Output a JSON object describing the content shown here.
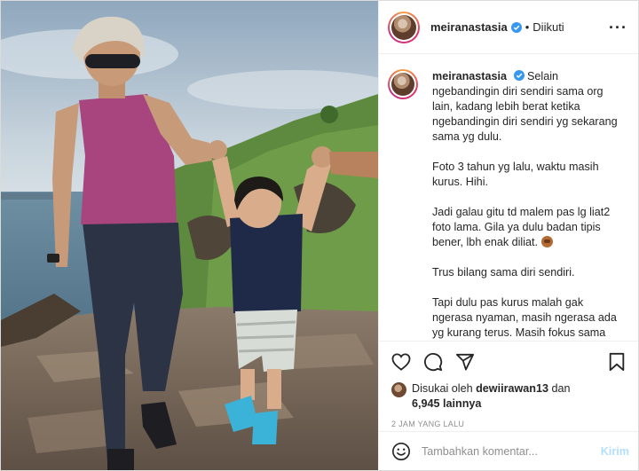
{
  "header": {
    "username": "meiranastasia",
    "separator": "•",
    "follow_status": "Diikuti",
    "more_glyph": "···"
  },
  "caption": {
    "username": "meiranastasia",
    "first_line": "Selain ngebandingin diri sendiri sama org lain, kadang lebih berat ketika ngebandingin diri sendiri yg sekarang sama yg dulu.",
    "paragraph_2": "Foto 3 tahun yg lalu, waktu masih kurus. Hihi.",
    "paragraph_3": "Jadi galau gitu td malem pas lg liat2 foto lama. Gila ya dulu badan tipis bener, lbh enak diliat.",
    "paragraph_3_emoji": "see-no-evil-monkey-emoji",
    "paragraph_4": "Trus bilang sama diri sendiri.",
    "paragraph_5": "Tapi dulu pas kurus malah gak ngerasa nyaman, masih ngerasa ada yg kurang terus. Masih fokus sama penampilan luar doang. Kalo ada yg"
  },
  "actions": {
    "icons": [
      "heart-icon",
      "comment-icon",
      "share-icon",
      "bookmark-icon"
    ]
  },
  "likes": {
    "prefix": "Disukai oleh",
    "user": "dewiirawan13",
    "conjunction": "dan",
    "count": "6,945 lainnya"
  },
  "timestamp": "2 JAM YANG LALU",
  "comment_box": {
    "placeholder": "Tambahkan komentar...",
    "post_label": "Kirim"
  },
  "colors": {
    "verified_blue": "#3897f0",
    "post_button_disabled": "#b2dffc",
    "text_primary": "#262626",
    "text_secondary": "#8e8e8e"
  }
}
